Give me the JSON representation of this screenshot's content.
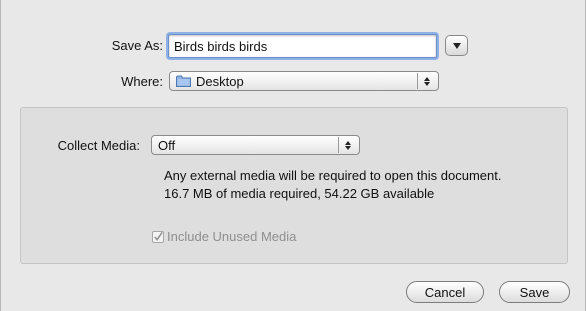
{
  "save_as": {
    "label": "Save As:",
    "value": "Birds birds birds"
  },
  "where": {
    "label": "Where:",
    "value": "Desktop"
  },
  "collect_media": {
    "label": "Collect Media:",
    "value": "Off",
    "info_line1": "Any external media will be required to open this document.",
    "info_line2": "16.7 MB of media required, 54.22 GB available"
  },
  "include_unused": {
    "label": "Include Unused Media",
    "checked": true,
    "enabled": false
  },
  "buttons": {
    "cancel": "Cancel",
    "save": "Save"
  },
  "icons": {
    "expand": "chevron-down-icon",
    "folder": "folder-icon",
    "popup_arrows": "up-down-arrows-icon",
    "checkmark": "checkmark-icon"
  }
}
